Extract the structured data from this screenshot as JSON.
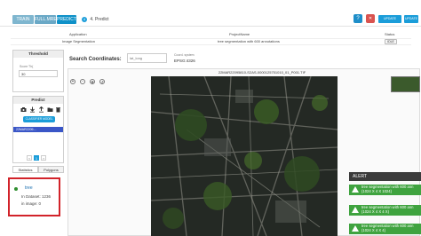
{
  "header": {
    "tabs": [
      "TRAIN",
      "FULL.MRE",
      "PREDICT"
    ],
    "step_number": "4",
    "step_label": "4. Predict",
    "help_glyph": "?",
    "upload_left": "UPDATE",
    "upload_right": "UPDATE"
  },
  "info": {
    "col_application": "Application",
    "col_project": "ProjectName",
    "col_status": "Status",
    "application": "Image Segmentation",
    "project": "tree segmentation with 600 annotations",
    "status": "IDLE"
  },
  "threshold": {
    "title": "Threshold",
    "field_label": "Score Th(",
    "value": "30"
  },
  "predict": {
    "title": "Predict",
    "run_button": "CLASSIFIER MODEL",
    "pages": [
      "1"
    ],
    "selected_item": "22MAR2209...."
  },
  "lower_tabs": [
    "Statistics",
    "Polygons"
  ],
  "legend": {
    "class_name": "tree",
    "in_dataset": "In Dataset: 1236",
    "in_image": "in image: 0"
  },
  "search": {
    "label": "Search Coordinates:",
    "placeholder": "lat_long",
    "coord_system_label": "Coord. system",
    "coord_system_value": "EPSG:4326"
  },
  "map": {
    "filename": "22MAR22095810-S2AS-0000125751010_01_P001.TIF",
    "zoom_in": "+",
    "zoom_out": "-"
  },
  "alerts": {
    "title": "ALERT",
    "items": [
      {
        "line1": "tree segmentation with 600 ann",
        "line2": "(1024 X 4 X 1024)"
      },
      {
        "line1": "tree segmentation with 600 ann",
        "line2": "(1024 X 4 X 4 X)"
      },
      {
        "line1": "tree segmentation with 600 ann",
        "line2": "(1024 X 4 X 4)"
      }
    ]
  }
}
